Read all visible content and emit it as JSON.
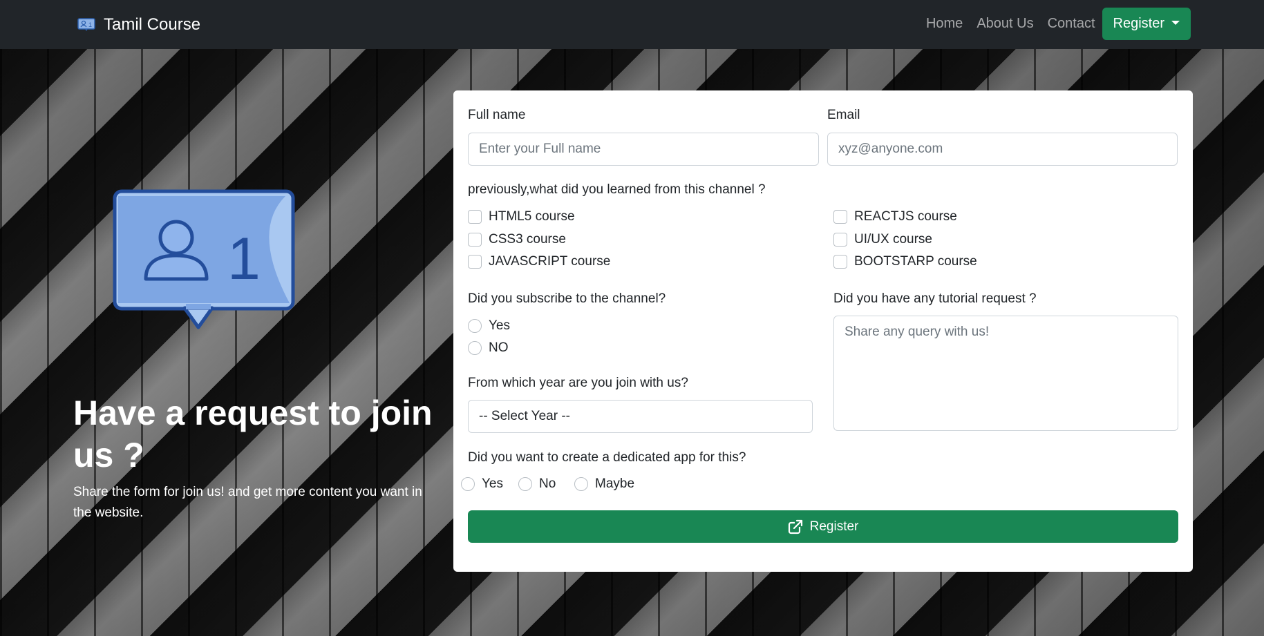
{
  "nav": {
    "brand": "Tamil Course",
    "links": [
      "Home",
      "About Us",
      "Contact"
    ],
    "register": "Register"
  },
  "hero": {
    "title": "Have a request to join us ?",
    "subtitle": "Share the form for join us! and get more content you want in the website.",
    "badge_count": "1"
  },
  "form": {
    "fullname_label": "Full name",
    "fullname_placeholder": "Enter your Full name",
    "email_label": "Email",
    "email_placeholder": "xyz@anyone.com",
    "learned_question": "previously,what did you learned from this channel ?",
    "courses_left": [
      "HTML5 course",
      "CSS3 course",
      "JAVASCRIPT course"
    ],
    "courses_right": [
      "REACTJS course",
      "UI/UX course",
      "BOOTSTARP course"
    ],
    "subscribe_question": "Did you subscribe to the channel?",
    "subscribe_options": [
      "Yes",
      "NO"
    ],
    "tutorial_question": "Did you have any tutorial request ?",
    "tutorial_placeholder": "Share any query with us!",
    "year_question": "From which year are you join with us?",
    "year_selected": "-- Select Year --",
    "app_question": "Did you want to create a dedicated app for this?",
    "app_options": [
      "Yes",
      "No",
      "Maybe"
    ],
    "submit_label": "Register"
  },
  "colors": {
    "navbar": "#212529",
    "accent": "#198754",
    "card": "#ffffff"
  }
}
